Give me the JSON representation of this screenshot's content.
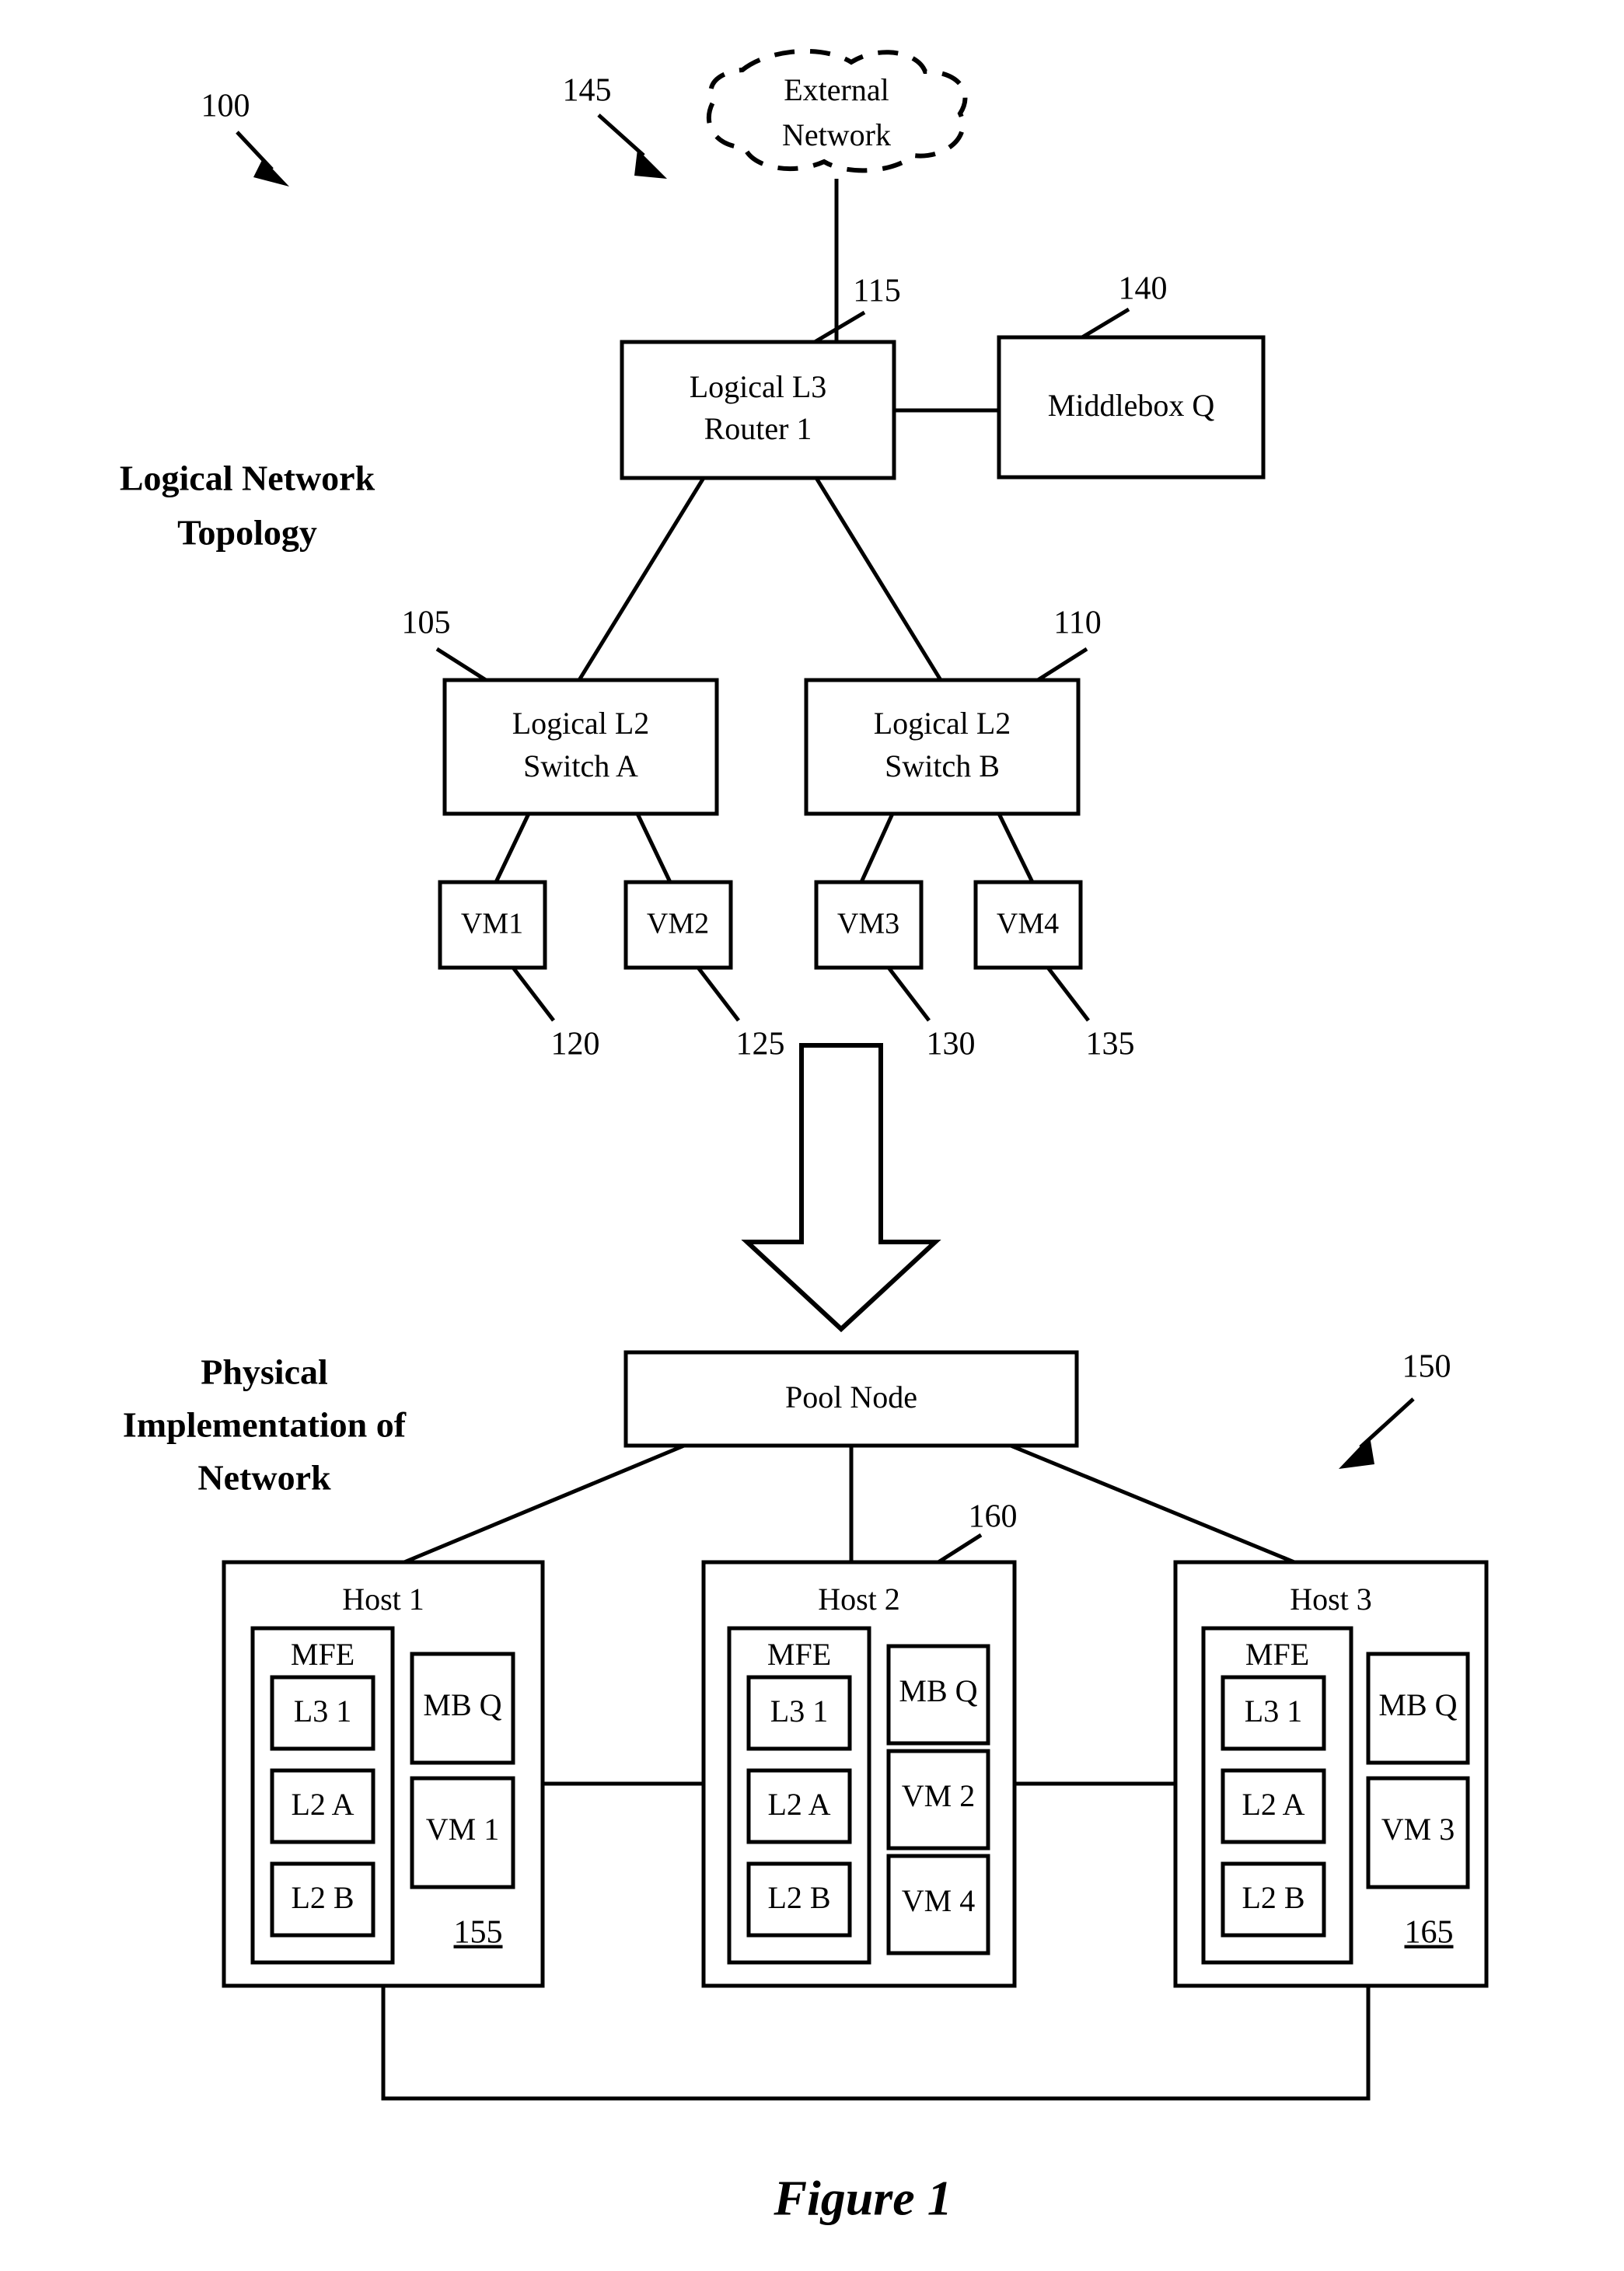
{
  "figure": {
    "caption": "Figure 1",
    "overall_ref": "100"
  },
  "sections": {
    "logical": {
      "title_line1": "Logical Network",
      "title_line2": "Topology"
    },
    "physical": {
      "title_line1": "Physical",
      "title_line2": "Implementation of",
      "title_line3": "Network",
      "ref": "150"
    }
  },
  "logical_topology": {
    "external_network": {
      "label_line1": "External",
      "label_line2": "Network",
      "ref": "145"
    },
    "router": {
      "label_line1": "Logical L3",
      "label_line2": "Router 1",
      "ref": "115"
    },
    "middlebox": {
      "label": "Middlebox Q",
      "ref": "140"
    },
    "switch_a": {
      "label_line1": "Logical L2",
      "label_line2": "Switch A",
      "ref": "105"
    },
    "switch_b": {
      "label_line1": "Logical L2",
      "label_line2": "Switch B",
      "ref": "110"
    },
    "vms": [
      {
        "label": "VM1",
        "ref": "120"
      },
      {
        "label": "VM2",
        "ref": "125"
      },
      {
        "label": "VM3",
        "ref": "130"
      },
      {
        "label": "VM4",
        "ref": "135"
      }
    ]
  },
  "physical_implementation": {
    "pool_node": {
      "label": "Pool Node"
    },
    "hosts": [
      {
        "title": "Host 1",
        "ref": "155",
        "mfe": {
          "label": "MFE",
          "elements": [
            "L3 1",
            "L2 A",
            "L2 B"
          ]
        },
        "right_column": [
          "MB Q",
          "VM 1"
        ]
      },
      {
        "title": "Host 2",
        "ref": "160",
        "mfe": {
          "label": "MFE",
          "elements": [
            "L3 1",
            "L2 A",
            "L2 B"
          ]
        },
        "right_column": [
          "MB Q",
          "VM 2",
          "VM 4"
        ]
      },
      {
        "title": "Host 3",
        "ref": "165",
        "mfe": {
          "label": "MFE",
          "elements": [
            "L3 1",
            "L2 A",
            "L2 B"
          ]
        },
        "right_column": [
          "MB Q",
          "VM 3"
        ]
      }
    ]
  },
  "colors": {
    "ink": "#000000",
    "paper": "#ffffff"
  }
}
